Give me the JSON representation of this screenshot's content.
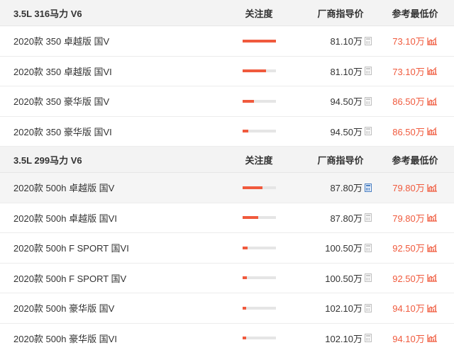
{
  "headers": {
    "attention": "关注度",
    "msrp": "厂商指导价",
    "lowest": "参考最低价"
  },
  "groups": [
    {
      "title": "3.5L 316马力 V6",
      "rows": [
        {
          "name": "2020款 350 卓越版 国V",
          "attention": 1.0,
          "msrp": "81.10万",
          "lowest": "73.10万"
        },
        {
          "name": "2020款 350 卓越版 国VI",
          "attention": 0.72,
          "msrp": "81.10万",
          "lowest": "73.10万"
        },
        {
          "name": "2020款 350 豪华版 国V",
          "attention": 0.35,
          "msrp": "94.50万",
          "lowest": "86.50万"
        },
        {
          "name": "2020款 350 豪华版 国VI",
          "attention": 0.18,
          "msrp": "94.50万",
          "lowest": "86.50万"
        }
      ]
    },
    {
      "title": "3.5L 299马力 V6",
      "rows": [
        {
          "name": "2020款 500h 卓越版 国V",
          "attention": 0.6,
          "msrp": "87.80万",
          "lowest": "79.80万",
          "highlight": true
        },
        {
          "name": "2020款 500h 卓越版 国VI",
          "attention": 0.48,
          "msrp": "87.80万",
          "lowest": "79.80万"
        },
        {
          "name": "2020款 500h F SPORT 国VI",
          "attention": 0.16,
          "msrp": "100.50万",
          "lowest": "92.50万"
        },
        {
          "name": "2020款 500h F SPORT 国V",
          "attention": 0.14,
          "msrp": "100.50万",
          "lowest": "92.50万"
        },
        {
          "name": "2020款 500h 豪华版 国V",
          "attention": 0.12,
          "msrp": "102.10万",
          "lowest": "94.10万"
        },
        {
          "name": "2020款 500h 豪华版 国VI",
          "attention": 0.12,
          "msrp": "102.10万",
          "lowest": "94.10万"
        }
      ]
    }
  ],
  "colors": {
    "accent": "#f05a3d",
    "bar_track": "#e5e5e5",
    "header_bg": "#f3f3f3"
  },
  "icons": {
    "calculator": "calculator-icon",
    "trend": "price-trend-icon"
  }
}
